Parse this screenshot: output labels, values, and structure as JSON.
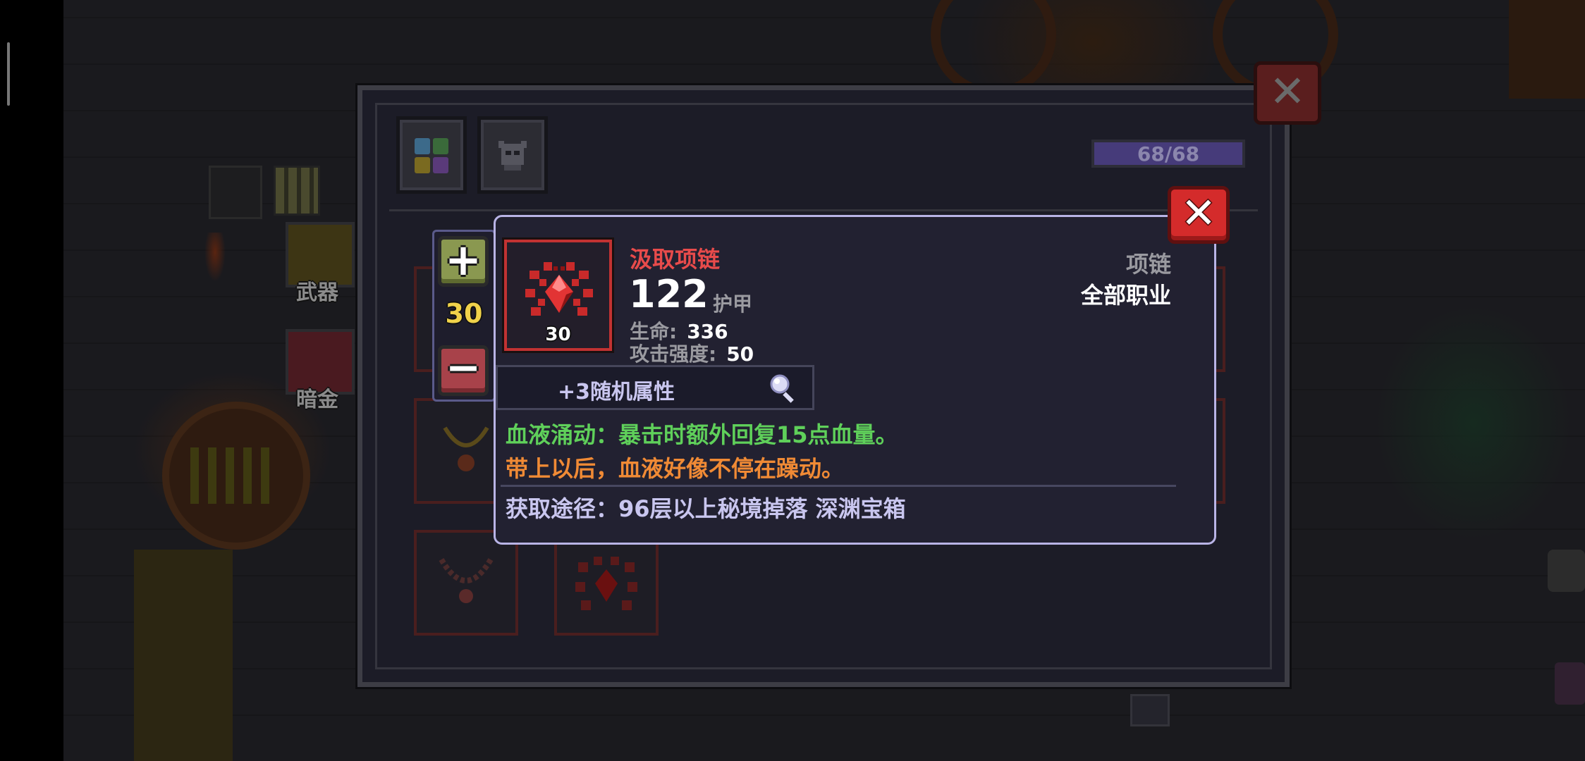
{
  "side_tabs": [
    {
      "label": "武器"
    },
    {
      "label": "暗金"
    }
  ],
  "inventory": {
    "count_text": "68/68",
    "close_symbol": "✕"
  },
  "level_adjuster": {
    "plus_symbol": "+",
    "minus_symbol": "−",
    "value": "30"
  },
  "item": {
    "name": "汲取项链",
    "name_color": "#e84b4b",
    "level": "30",
    "armor_value": "122",
    "armor_label": "护甲",
    "stats": [
      {
        "label": "生命:",
        "value": "336"
      },
      {
        "label": "攻击强度:",
        "value": "50"
      }
    ],
    "type": "项链",
    "class_restriction": "全部职业",
    "random_attrs": "+3随机属性",
    "effect_text": "血液涌动：暴击时额外回复15点血量。",
    "effect_color": "#5fd05a",
    "flavor_text": "带上以后，血液好像不停在躁动。",
    "flavor_color": "#f08a35",
    "source_text": "获取途径：96层以上秘境掉落 深渊宝箱",
    "icon": "red-spider-gem-icon"
  },
  "tooltip": {
    "close_symbol": "✕"
  }
}
